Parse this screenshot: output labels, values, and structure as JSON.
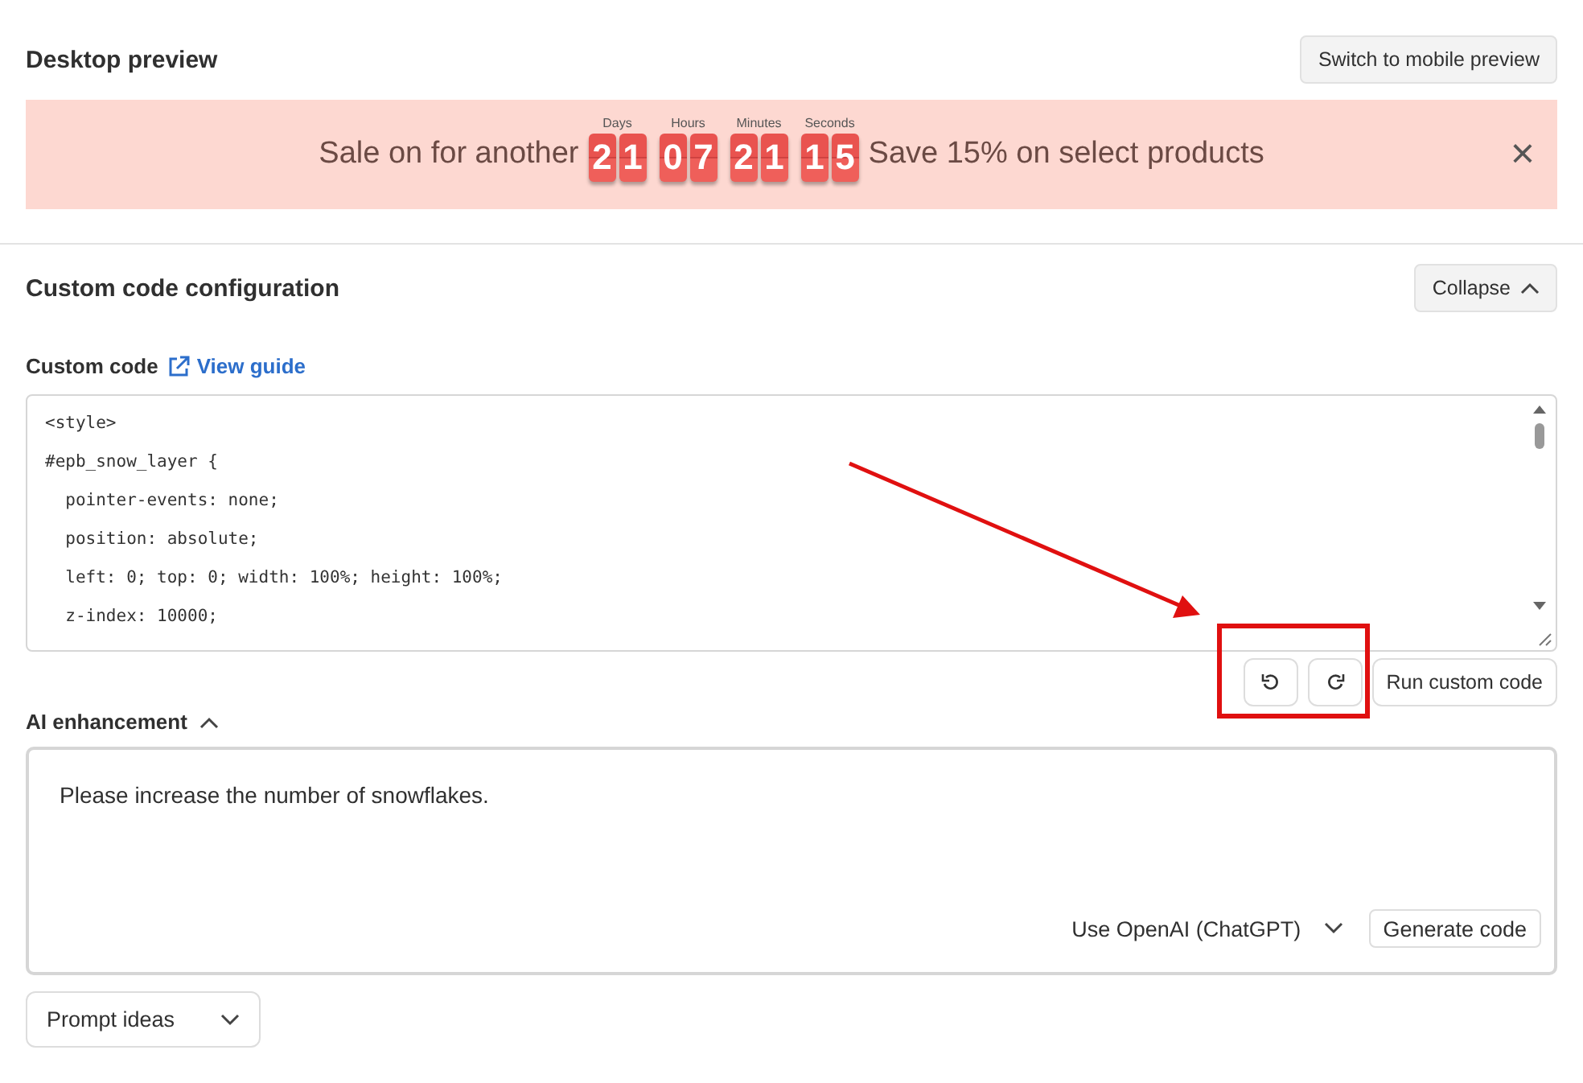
{
  "header": {
    "title": "Desktop preview",
    "switch_button": "Switch to mobile preview"
  },
  "banner": {
    "text_before": "Sale on for another",
    "text_after": "Save 15% on select products",
    "close": "×",
    "countdown": [
      {
        "label": "Days",
        "digits": [
          "2",
          "1"
        ]
      },
      {
        "label": "Hours",
        "digits": [
          "0",
          "7"
        ]
      },
      {
        "label": "Minutes",
        "digits": [
          "2",
          "1"
        ]
      },
      {
        "label": "Seconds",
        "digits": [
          "1",
          "5"
        ]
      }
    ]
  },
  "config": {
    "title": "Custom code configuration",
    "collapse_button": "Collapse",
    "expanded": true,
    "code_label": "Custom code",
    "guide_link": "View guide",
    "code_lines": [
      "<style>",
      "#epb_snow_layer {",
      "  pointer-events: none;",
      "  position: absolute;",
      "  left: 0; top: 0; width: 100%; height: 100%;",
      "  z-index: 10000;"
    ],
    "run_button": "Run custom code"
  },
  "ai": {
    "title": "AI enhancement",
    "expanded": true,
    "prompt": "Please increase the number of snowflakes.",
    "model_select": "Use OpenAI (ChatGPT)",
    "generate_button": "Generate code",
    "prompt_ideas": "Prompt ideas"
  },
  "annotations": {
    "arrow_shown": true,
    "highlight_shown": true
  }
}
